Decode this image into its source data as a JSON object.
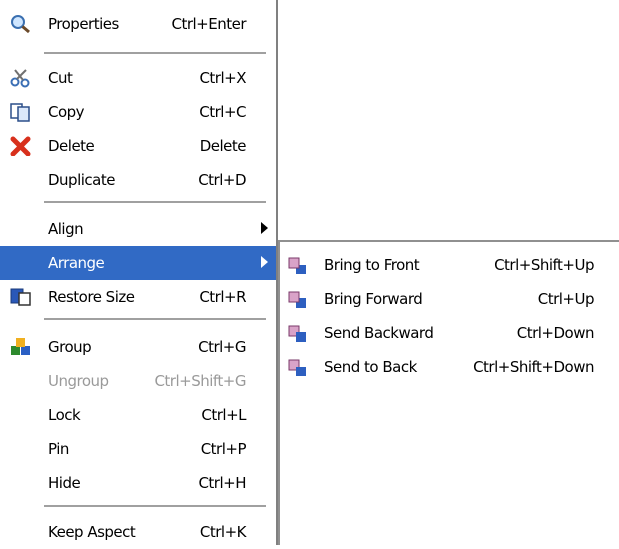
{
  "menu": {
    "properties": {
      "label": "Properties",
      "shortcut": "Ctrl+Enter",
      "icon": "magnifier-icon"
    },
    "cut": {
      "label": "Cut",
      "shortcut": "Ctrl+X",
      "icon": "scissors-icon"
    },
    "copy": {
      "label": "Copy",
      "shortcut": "Ctrl+C",
      "icon": "copy-icon"
    },
    "delete": {
      "label": "Delete",
      "shortcut": "Delete",
      "icon": "red-x-icon"
    },
    "duplicate": {
      "label": "Duplicate",
      "shortcut": "Ctrl+D"
    },
    "align": {
      "label": "Align"
    },
    "arrange": {
      "label": "Arrange"
    },
    "restore_size": {
      "label": "Restore Size",
      "shortcut": "Ctrl+R",
      "icon": "restore-size-icon"
    },
    "group": {
      "label": "Group",
      "shortcut": "Ctrl+G",
      "icon": "group-shapes-icon"
    },
    "ungroup": {
      "label": "Ungroup",
      "shortcut": "Ctrl+Shift+G"
    },
    "lock": {
      "label": "Lock",
      "shortcut": "Ctrl+L"
    },
    "pin": {
      "label": "Pin",
      "shortcut": "Ctrl+P"
    },
    "hide": {
      "label": "Hide",
      "shortcut": "Ctrl+H"
    },
    "keep_aspect": {
      "label": "Keep Aspect",
      "shortcut": "Ctrl+K"
    }
  },
  "submenu": {
    "bring_to_front": {
      "label": "Bring to Front",
      "shortcut": "Ctrl+Shift+Up",
      "icon": "bring-to-front-icon"
    },
    "bring_forward": {
      "label": "Bring Forward",
      "shortcut": "Ctrl+Up",
      "icon": "bring-forward-icon"
    },
    "send_backward": {
      "label": "Send Backward",
      "shortcut": "Ctrl+Down",
      "icon": "send-backward-icon"
    },
    "send_to_back": {
      "label": "Send to Back",
      "shortcut": "Ctrl+Shift+Down",
      "icon": "send-to-back-icon"
    }
  },
  "colors": {
    "highlight": "#316ac5",
    "disabled_text": "#9a9a9a",
    "separator": "#a0a0a0"
  }
}
